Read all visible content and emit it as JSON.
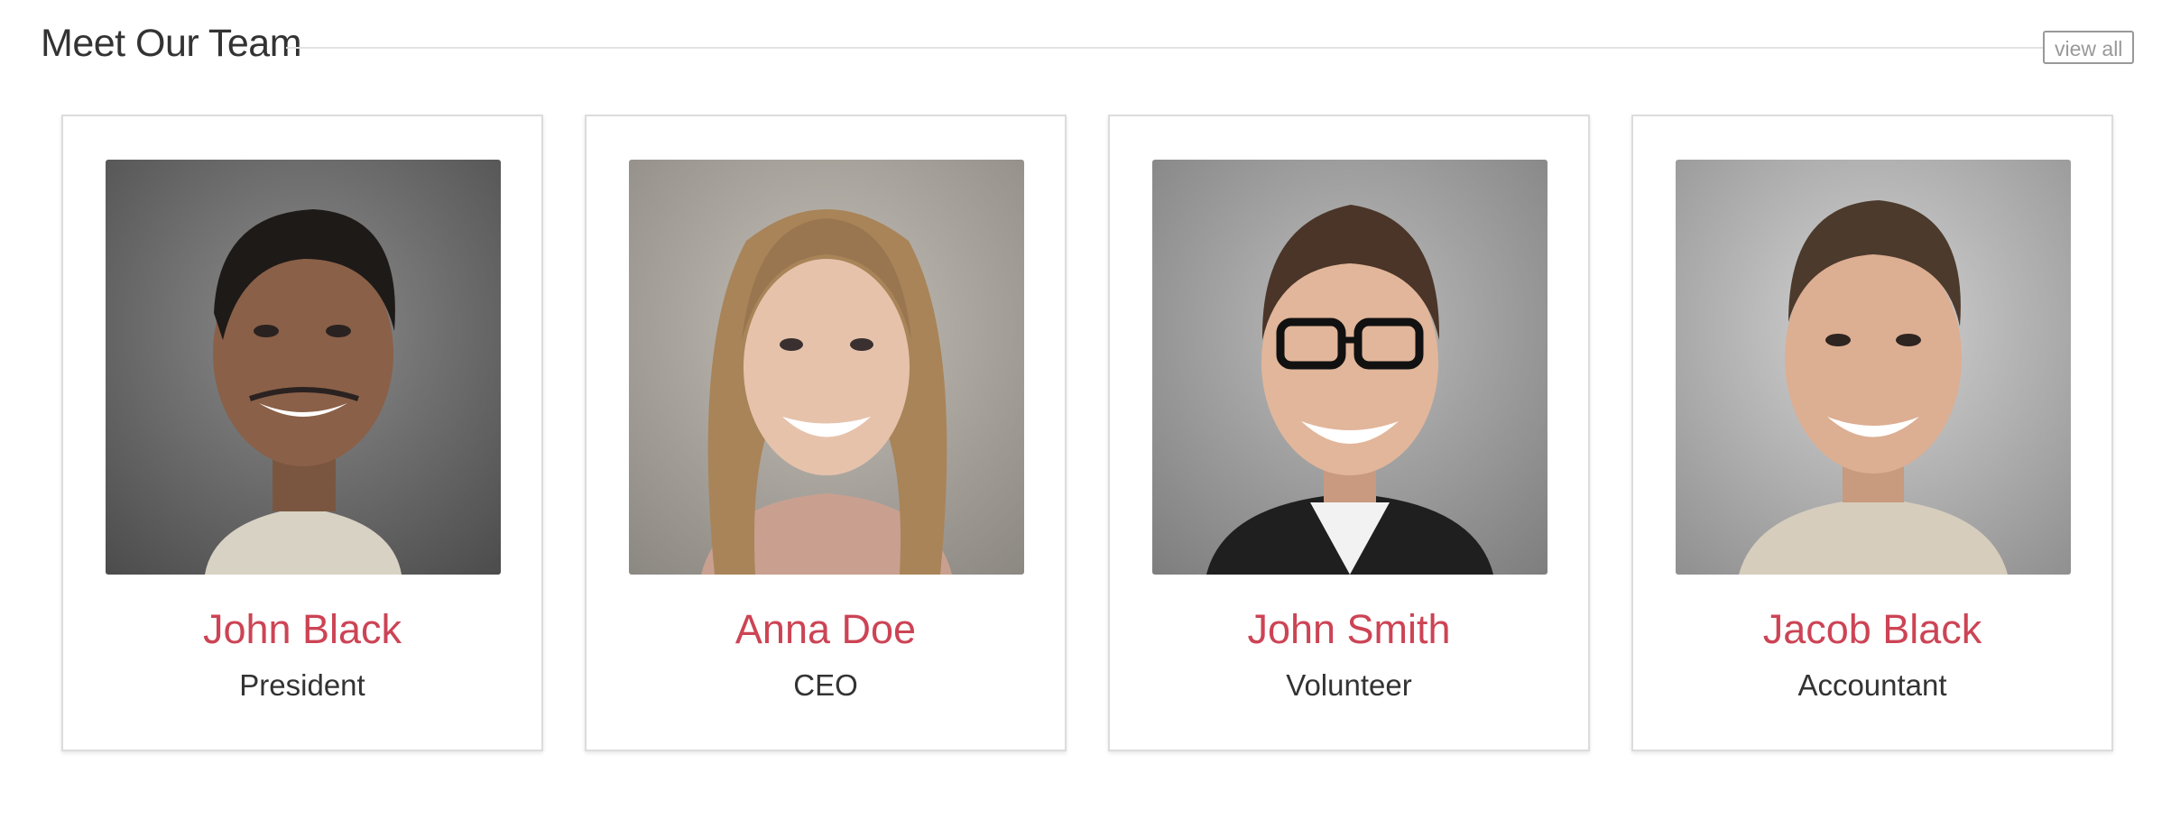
{
  "section": {
    "title": "Meet Our Team",
    "view_all_label": "view all"
  },
  "members": [
    {
      "name": "John Black",
      "role": "President"
    },
    {
      "name": "Anna Doe",
      "role": "CEO"
    },
    {
      "name": "John Smith",
      "role": "Volunteer"
    },
    {
      "name": "Jacob Black",
      "role": "Accountant"
    }
  ],
  "colors": {
    "accent": "#cc4455",
    "text": "#333333",
    "muted": "#999999",
    "card_border": "#dcdcdc"
  }
}
